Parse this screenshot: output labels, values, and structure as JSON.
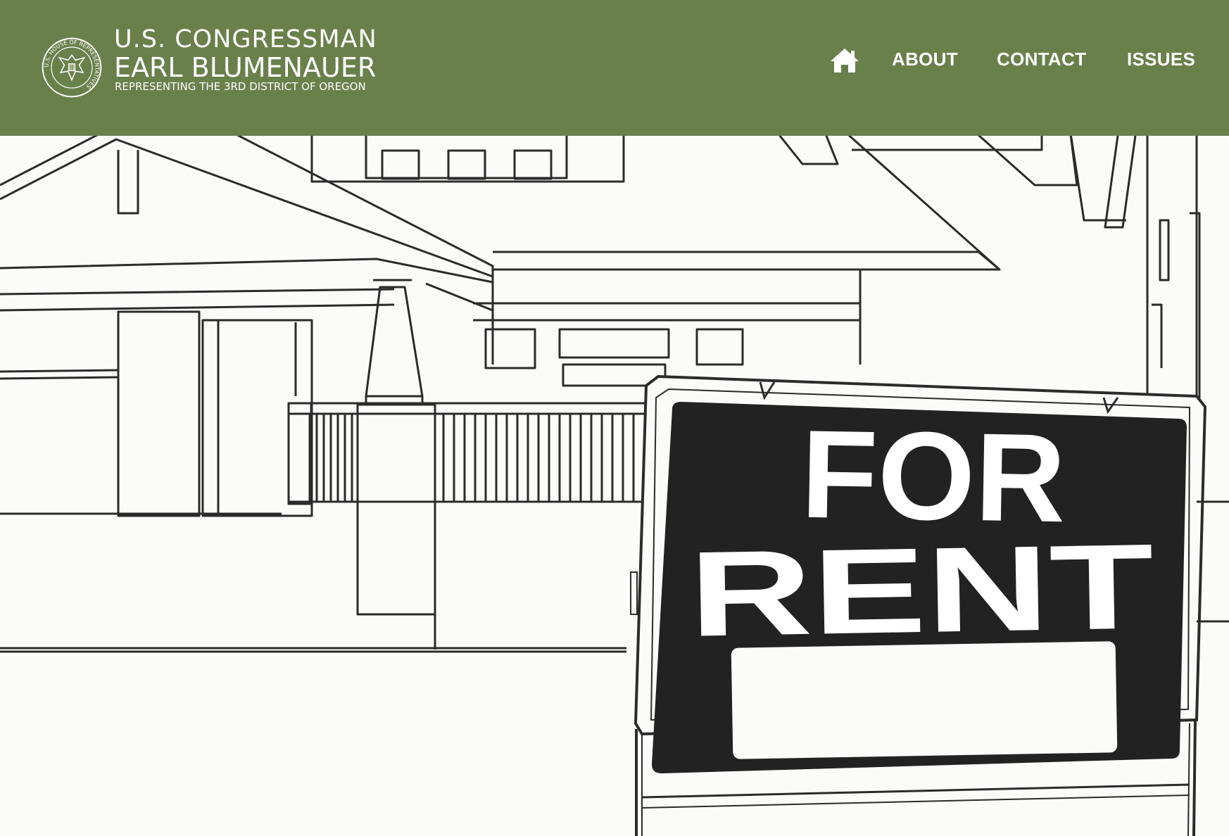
{
  "header": {
    "title_line1": "U.S. CONGRESSMAN",
    "title_line2": "EARL BLUMENAUER",
    "subtitle": "REPRESENTING THE 3RD DISTRICT OF OREGON",
    "seal_icon": "house-of-representatives-seal-icon",
    "seal_text": "U.S. HOUSE OF REPRESENTATIVES",
    "background_color": "#69804b"
  },
  "nav": {
    "home_icon": "home-icon",
    "items": [
      {
        "label": "ABOUT"
      },
      {
        "label": "CONTACT"
      },
      {
        "label": "ISSUES"
      }
    ]
  },
  "hero": {
    "sign_line1": "FOR",
    "sign_line2": "RENT"
  }
}
